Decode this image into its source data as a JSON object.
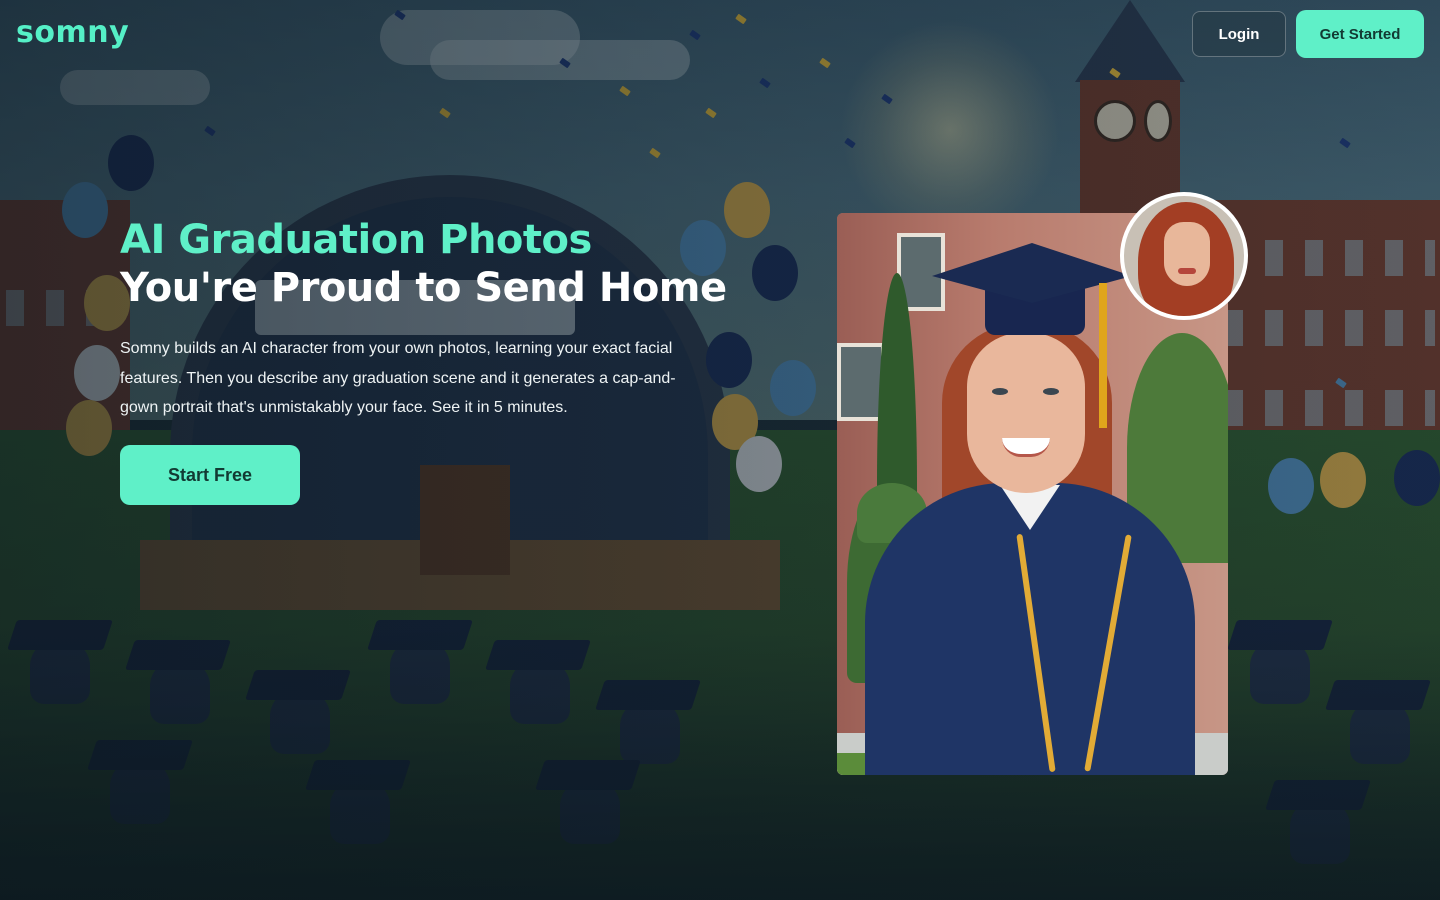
{
  "header": {
    "logo_text": "somny",
    "login_label": "Login",
    "get_started_label": "Get Started"
  },
  "hero": {
    "title_line1": "AI Graduation Photos",
    "title_line2": "You're Proud to Send Home",
    "description": "Somny builds an AI character from your own photos, learning your exact facial features. Then you describe any graduation scene and it generates a cap-and-gown portrait that's unmistakably your face. See it in 5 minutes.",
    "cta_label": "Start Free"
  },
  "colors": {
    "accent": "#5ff0c8",
    "logo": "#55f0c7",
    "cta_text": "#123a33",
    "headline_white": "#ffffff"
  },
  "media": {
    "background_icon": "graduation-ceremony-illustration",
    "photo_icon": "graduate-portrait-photo",
    "avatar_icon": "user-reference-photo"
  }
}
